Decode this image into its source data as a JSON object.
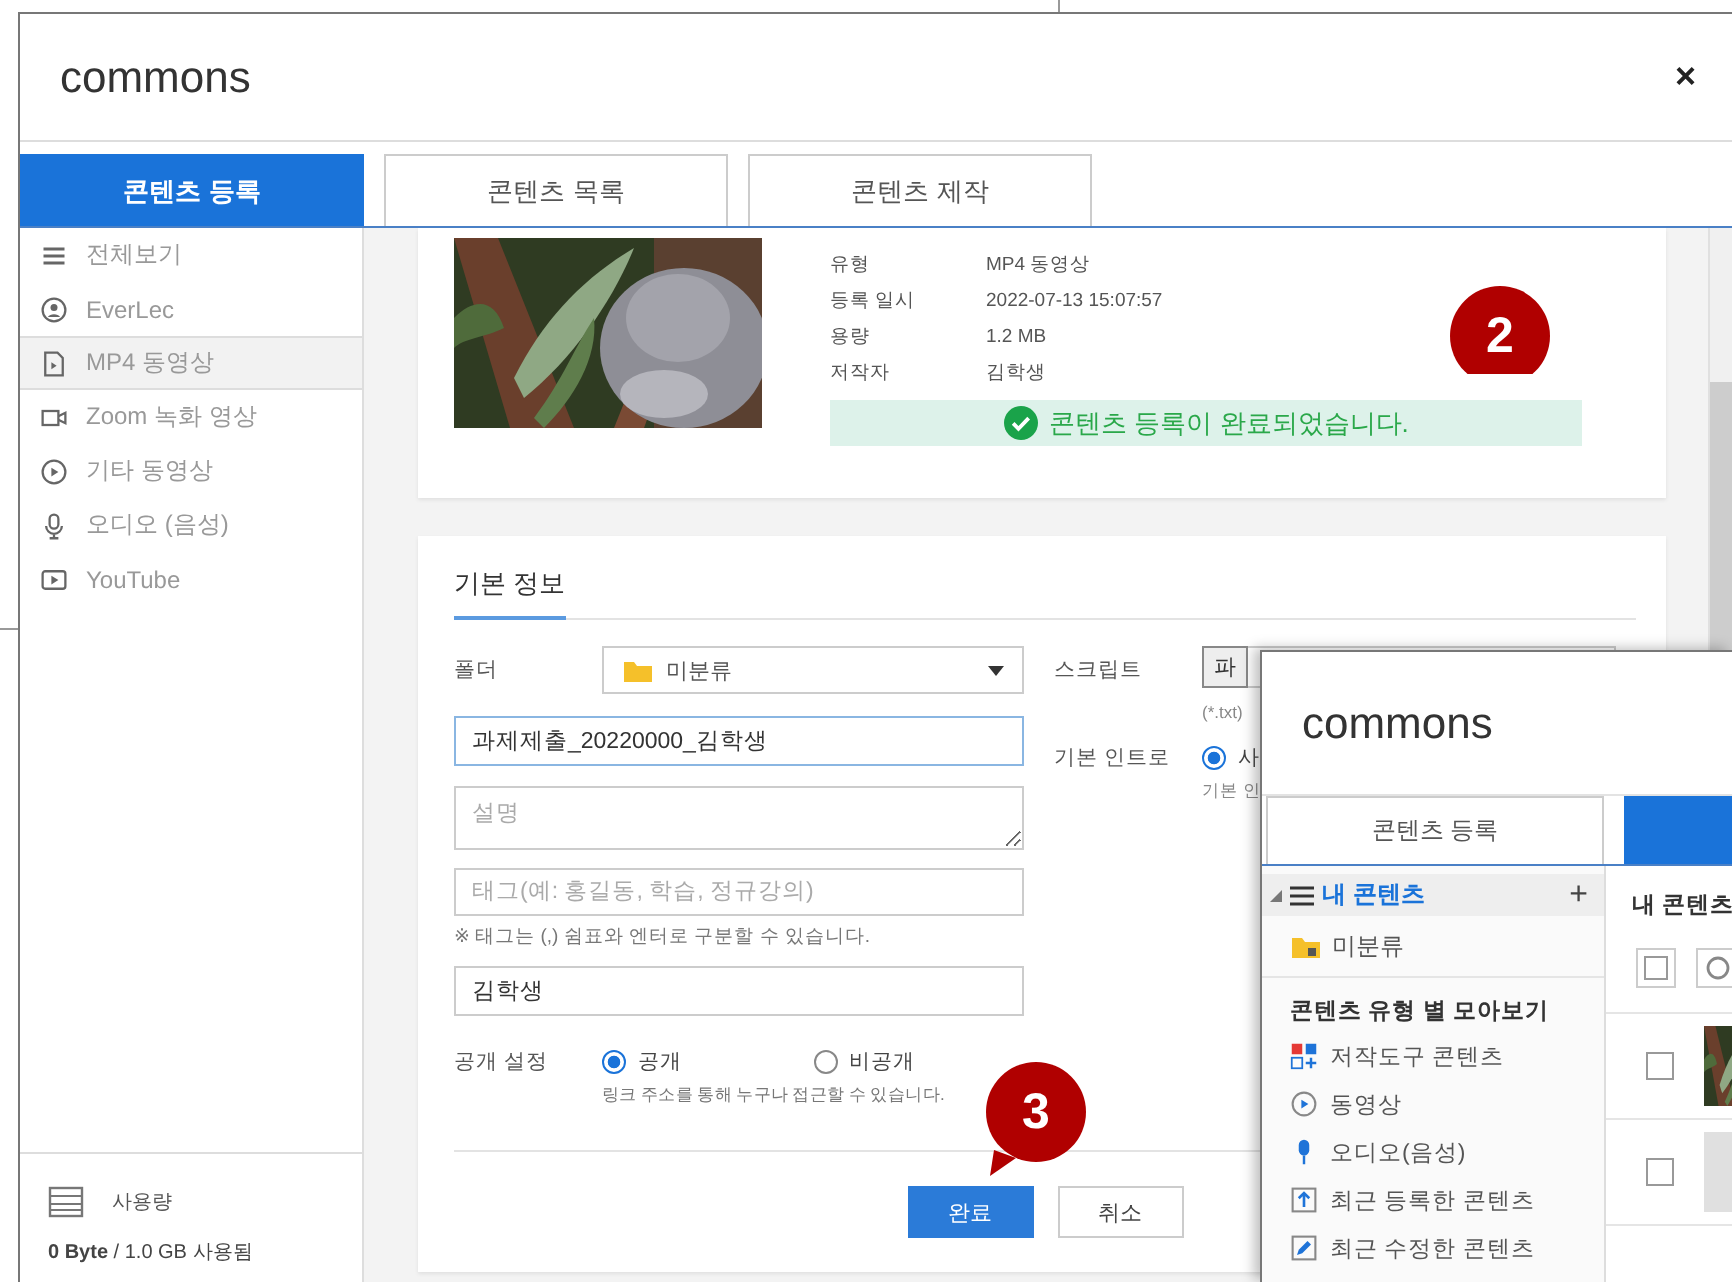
{
  "main_window": {
    "title": "commons",
    "close": "×",
    "tabs": [
      {
        "label": "콘텐츠 등록",
        "selected": true
      },
      {
        "label": "콘텐츠 목록",
        "selected": false
      },
      {
        "label": "콘텐츠 제작",
        "selected": false
      }
    ],
    "sidebar": {
      "items": [
        {
          "label": "전체보기",
          "selected": false
        },
        {
          "label": "EverLec",
          "selected": false
        },
        {
          "label": "MP4 동영상",
          "selected": true
        },
        {
          "label": "Zoom 녹화 영상",
          "selected": false
        },
        {
          "label": "기타 동영상",
          "selected": false
        },
        {
          "label": "오디오 (음성)",
          "selected": false
        },
        {
          "label": "YouTube",
          "selected": false
        }
      ],
      "usage_label": "사용량",
      "usage_text": "**0 Byte** / 1.0 GB 사용됨"
    },
    "file_info": {
      "details": [
        {
          "label": "유형",
          "value": "MP4 동영상"
        },
        {
          "label": "등록 일시",
          "value": "2022-07-13 15:07:57"
        },
        {
          "label": "용량",
          "value": "1.2 MB"
        },
        {
          "label": "저작자",
          "value": "김학생"
        }
      ],
      "status_message": "콘텐츠 등록이 완료되었습니다."
    },
    "form": {
      "section_title": "기본 정보",
      "folder": {
        "label": "폴더",
        "value": "미분류"
      },
      "title_field": {
        "value": "과제제출_20220000_김학생",
        "focused": true
      },
      "description": {
        "placeholder": "설명"
      },
      "tags": {
        "placeholder": "태그(예: 홍길동, 학습, 정규강의)",
        "hint": "※ 태그는 (,) 쉼표와 엔터로 구분할 수 있습니다."
      },
      "author": {
        "value": "김학생"
      },
      "visibility": {
        "label": "공개 설정",
        "options": [
          {
            "label": "공개",
            "selected": true
          },
          {
            "label": "비공개",
            "selected": false
          }
        ],
        "hint": "링크 주소를 통해 누구나 접근할 수 있습니다."
      },
      "script": {
        "label": "스크립트",
        "button": "파",
        "hint": "(*.txt)"
      },
      "intro": {
        "label": "기본 인트로",
        "options": [
          {
            "label": "사",
            "selected": true
          }
        ],
        "hint": "기본 인"
      },
      "buttons": [
        {
          "label": "완료",
          "kind": "primary"
        },
        {
          "label": "취소",
          "kind": "secondary"
        }
      ]
    }
  },
  "overlay_window": {
    "title": "commons",
    "tabs": [
      {
        "label": "콘텐츠 등록",
        "selected": false
      },
      {
        "selected": true
      }
    ],
    "tree": {
      "label": "내 콘텐츠",
      "expanded": true,
      "add": "+",
      "children": [
        {
          "label": "미분류"
        }
      ]
    },
    "category_heading": "콘텐츠 유형 별 모아보기",
    "categories": [
      {
        "label": "저작도구 콘텐츠"
      },
      {
        "label": "동영상"
      },
      {
        "label": "오디오(음성)"
      },
      {
        "label": "최근 등록한 콘텐츠"
      },
      {
        "label": "최근 수정한 콘텐츠"
      }
    ],
    "list_title": "내 콘텐츠",
    "select_all": {
      "checked": false
    },
    "rows": [
      {
        "checked": false,
        "kind": "picture"
      },
      {
        "checked": false,
        "kind": "blank"
      }
    ]
  },
  "callouts": [
    {
      "number": "2"
    },
    {
      "number": "3"
    }
  ]
}
